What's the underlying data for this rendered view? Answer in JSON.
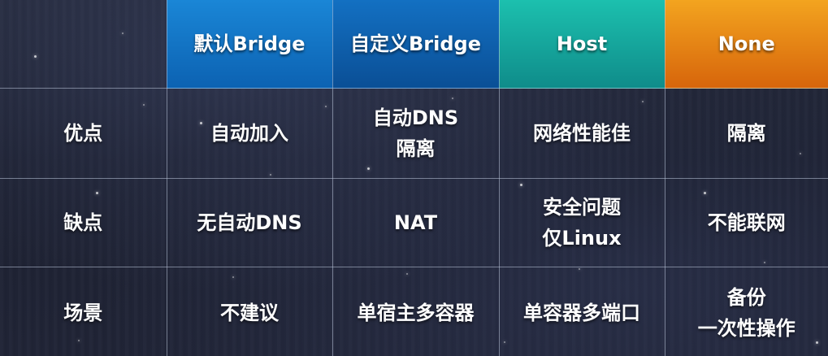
{
  "headers": [
    "默认Bridge",
    "自定义Bridge",
    "Host",
    "None"
  ],
  "header_colors": [
    "#1a86d6",
    "#1370c2",
    "#1cc0ae",
    "#f3a41f"
  ],
  "rows": [
    {
      "label": "优点",
      "label_color": "#ffd21f",
      "cells": [
        "自动加入",
        "自动DNS\n隔离",
        "网络性能佳",
        "隔离"
      ]
    },
    {
      "label": "缺点",
      "label_color": "#ff2b1f",
      "cells": [
        "无自动DNS",
        "NAT",
        "安全问题\n仅Linux",
        "不能联网"
      ]
    },
    {
      "label": "场景",
      "label_color": "#22d3bf",
      "cells": [
        "不建议",
        "单宿主多容器",
        "单容器多端口",
        "备份\n一次性操作"
      ]
    }
  ]
}
